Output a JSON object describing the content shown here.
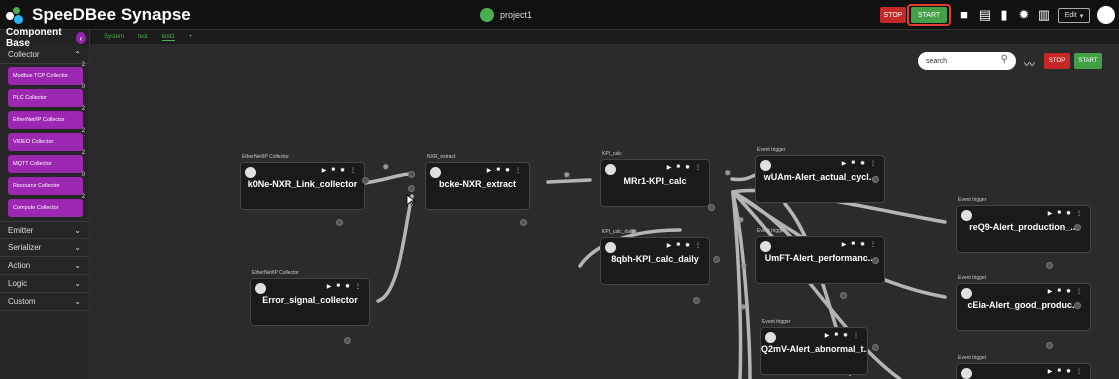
{
  "app": {
    "title": "SpeeDBee Synapse",
    "project": "project1"
  },
  "toolbar": {
    "stop_label": "STOP",
    "start_label": "START",
    "edit_label": "Edit"
  },
  "sidebar": {
    "title": "Component Base",
    "collector_label": "Collector",
    "items": [
      {
        "label": "Modbus TCP Collector",
        "badge": "2"
      },
      {
        "label": "PLC Collector",
        "badge": "0"
      },
      {
        "label": "EtherNet/IP Collector",
        "badge": "2"
      },
      {
        "label": "VIDEO Collector",
        "badge": "2"
      },
      {
        "label": "MQTT Collector",
        "badge": "2"
      },
      {
        "label": "Resource Collector",
        "badge": "0"
      },
      {
        "label": "Compute Collector",
        "badge": "2"
      }
    ],
    "categories": [
      "Emitter",
      "Serializer",
      "Action",
      "Logic",
      "Custom"
    ]
  },
  "tabs": [
    "System",
    "test",
    "test1",
    "+"
  ],
  "canvas": {
    "search_placeholder": "search",
    "stop_label": "STOP",
    "start_label": "START",
    "nodes": [
      {
        "type": "EtherNet/IP Collector",
        "name": "k0Ne-NXR_Link_collector"
      },
      {
        "type": "NXR_extract",
        "name": "bcke-NXR_extract"
      },
      {
        "type": "KPI_calc",
        "name": "MRr1-KPI_calc"
      },
      {
        "type": "KPI_calc_daily",
        "name": "8qbh-KPI_calc_daily"
      },
      {
        "type": "EtherNet/IP Collector",
        "name": "Error_signal_collector"
      },
      {
        "type": "Event trigger",
        "name": "wUAm-Alert_actual_cycl..."
      },
      {
        "type": "Event trigger",
        "name": "UmFT-Alert_performanc..."
      },
      {
        "type": "Event trigger",
        "name": "Q2mV-Alert_abnormal_t..."
      },
      {
        "type": "Event trigger",
        "name": "reQ9-Alert_production_..."
      },
      {
        "type": "Event trigger",
        "name": "cEia-Alert_good_produc..."
      },
      {
        "type": "Event trigger",
        "name": ""
      }
    ]
  }
}
